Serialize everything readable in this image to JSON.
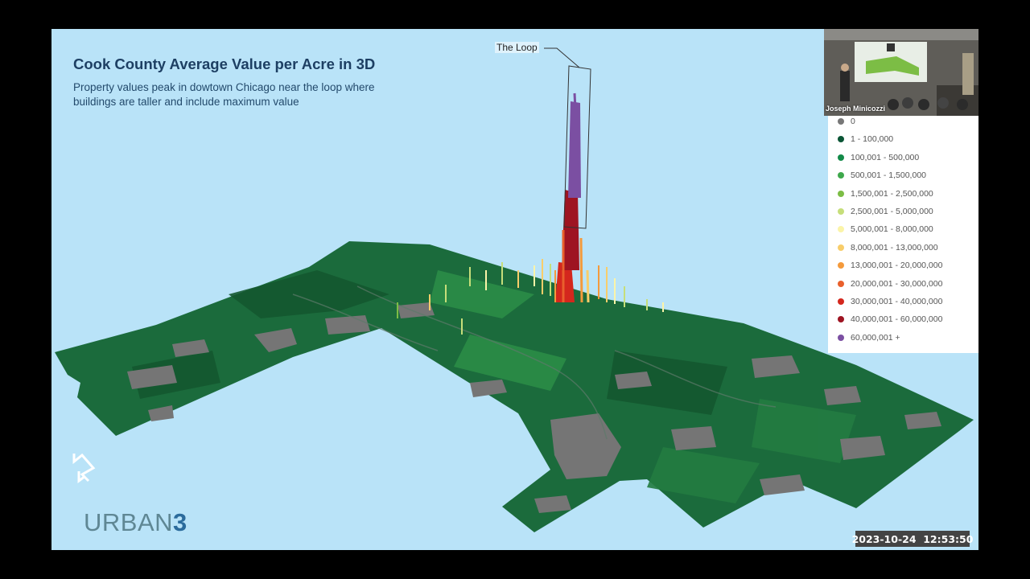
{
  "slide": {
    "title": "Cook County Average Value per Acre in 3D",
    "subtitle": "Property values peak in dowtown Chicago near the loop where buildings are taller and include maximum value",
    "annotation": "The Loop",
    "brand_prefix": "URBAN",
    "brand_suffix": "3",
    "logo_icon": "urban3-mark-icon"
  },
  "legend": {
    "items": [
      {
        "label": "0",
        "color": "#777777"
      },
      {
        "label": "1 - 100,000",
        "color": "#0a5535"
      },
      {
        "label": "100,001 - 500,000",
        "color": "#128a48"
      },
      {
        "label": "500,001 - 1,500,000",
        "color": "#3ea84c"
      },
      {
        "label": "1,500,001 - 2,500,000",
        "color": "#7cbd45"
      },
      {
        "label": "2,500,001 - 5,000,000",
        "color": "#c6de7a"
      },
      {
        "label": "5,000,001 - 8,000,000",
        "color": "#fbf4a8"
      },
      {
        "label": "8,000,001 - 13,000,000",
        "color": "#f8cd6a"
      },
      {
        "label": "13,000,001 - 20,000,000",
        "color": "#f49a3c"
      },
      {
        "label": "20,000,001 - 30,000,000",
        "color": "#e9602c"
      },
      {
        "label": "30,000,001 - 40,000,000",
        "color": "#d4271d"
      },
      {
        "label": "40,000,001 - 60,000,000",
        "color": "#9e1422"
      },
      {
        "label": "60,000,001 +",
        "color": "#7b4fa2"
      }
    ]
  },
  "video": {
    "speaker_name": "Joseph Minicozzi"
  },
  "timestamp": "2023-10-24  12:53:50",
  "colors": {
    "background": "#b9e3f8",
    "land": "#1b6b3c",
    "gray": "#757575"
  }
}
